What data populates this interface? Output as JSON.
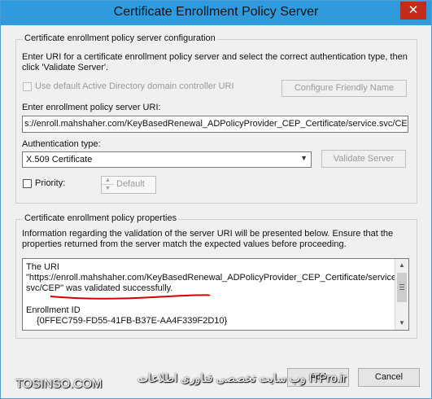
{
  "window": {
    "title": "Certificate Enrollment Policy Server",
    "close_glyph": "✕"
  },
  "config_group": {
    "legend": "Certificate enrollment policy server configuration",
    "instructions_line1": "Enter URI for a certificate enrollment policy server and select the correct authentication type, then",
    "instructions_line2": "click 'Validate Server'.",
    "default_ad_label": "Use default Active Directory domain controller URI",
    "configure_friendly_name_label": "Configure Friendly Name",
    "uri_label": "Enter enrollment policy server URI:",
    "uri_value": "s://enroll.mahshaher.com/KeyBasedRenewal_ADPolicyProvider_CEP_Certificate/service.svc/CEP",
    "auth_label": "Authentication type:",
    "auth_value": "X.509 Certificate",
    "validate_server_label": "Validate Server",
    "priority_label": "Priority:",
    "priority_value": "Default"
  },
  "properties_group": {
    "legend": "Certificate enrollment policy properties",
    "info_line1": "Information regarding the validation of the server URI will be presented below. Ensure that the",
    "info_line2": "properties returned from the server match the expected values before proceeding.",
    "result_lines": {
      "l1": "The URI",
      "l2": "\"https://enroll.mahshaher.com/KeyBasedRenewal_ADPolicyProvider_CEP_Certificate/service.",
      "l3": "svc/CEP\" was validated successfully.",
      "l4": "Enrollment ID",
      "l5": "{0FFEC759-FD55-41FB-B37E-AA4F339F2D10}"
    }
  },
  "footer": {
    "add_label": "Add",
    "cancel_label": "Cancel"
  },
  "watermarks": {
    "left": "TOSINSO.COM",
    "right": "وب سایت تخصصی فناوری اطلاعات ITPro.ir"
  },
  "colors": {
    "titlebar": "#2f9bde",
    "close": "#c42b1c",
    "underline": "#d40000"
  }
}
